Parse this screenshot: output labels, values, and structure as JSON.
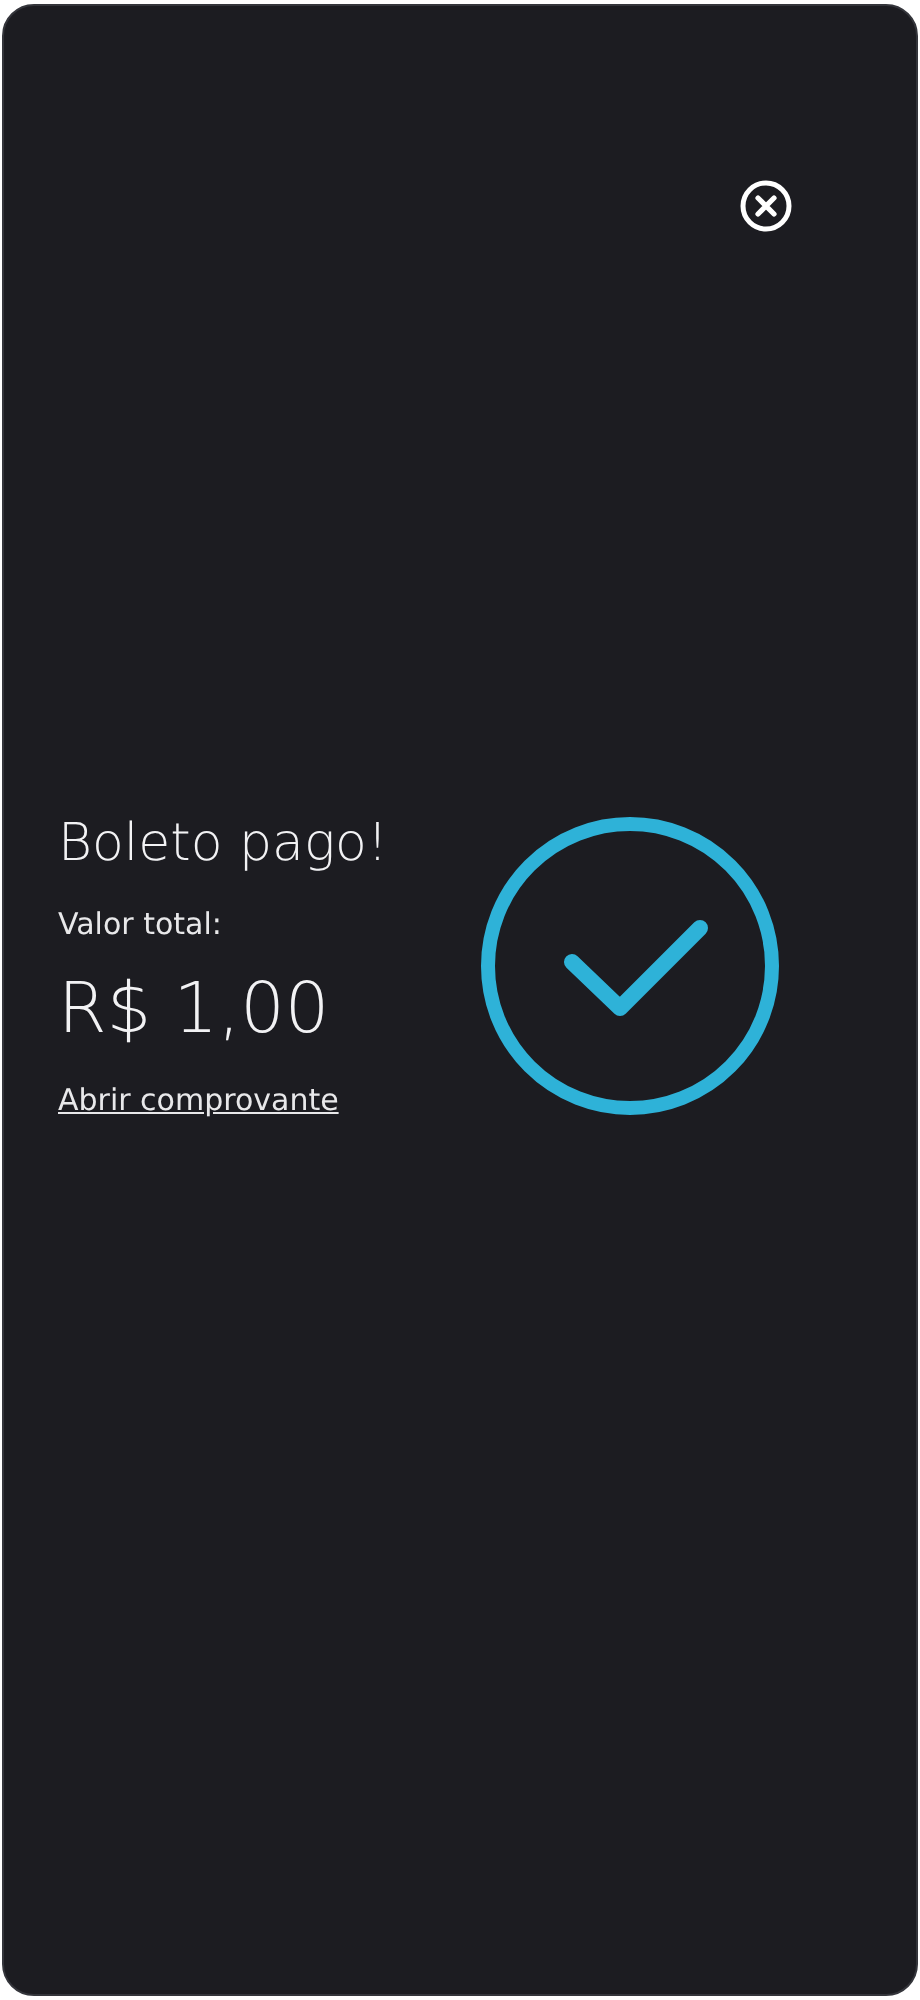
{
  "title": "Boleto pago!",
  "amount_label": "Valor total:",
  "amount": "R$ 1,00",
  "receipt_link": "Abrir comprovante"
}
